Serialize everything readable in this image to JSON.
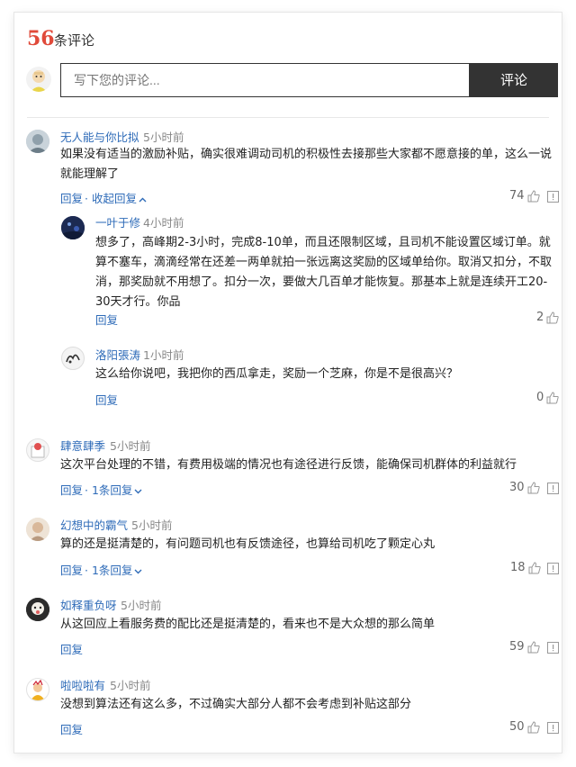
{
  "header": {
    "count": "56",
    "count_label": "条评论"
  },
  "compose": {
    "placeholder": "写下您的评论...",
    "submit_label": "评论"
  },
  "comments": [
    {
      "user": "无人能与你比拟",
      "time": "5小时前",
      "text": "如果没有适当的激励补贴，确实很难调动司机的积极性去接那些大家都不愿意接的单，这么一说就能理解了",
      "reply_label": "回复",
      "toggle_label": "· 收起回复",
      "likes": "74",
      "replies": [
        {
          "user": "一叶于修",
          "time": "4小时前",
          "text": "想多了，高峰期2-3小时，完成8-10单，而且还限制区域，且司机不能设置区域订单。就算不塞车，滴滴经常在还差一两单就拍一张远离这奖励的区域单给你。取消又扣分，不取消，那奖励就不用想了。扣分一次，要做大几百单才能恢复。那基本上就是连续开工20-30天才行。你品",
          "reply_label": "回复",
          "likes": "2"
        },
        {
          "user": "洛阳張涛",
          "time": "1小时前",
          "text": "这么给你说吧，我把你的西瓜拿走，奖励一个芝麻，你是不是很高兴？",
          "reply_label": "回复",
          "likes": "0"
        }
      ]
    },
    {
      "user": "肆意肆季",
      "time": "5小时前",
      "text": "这次平台处理的不错，有费用极端的情况也有途径进行反馈，能确保司机群体的利益就行",
      "reply_label": "回复",
      "toggle_label": "· 1条回复",
      "likes": "30"
    },
    {
      "user": "幻想中的霸气",
      "time": "5小时前",
      "text": "算的还是挺清楚的，有问题司机也有反馈途径，也算给司机吃了颗定心丸",
      "reply_label": "回复",
      "toggle_label": "· 1条回复",
      "likes": "18"
    },
    {
      "user": "如释重负呀",
      "time": "5小时前",
      "text": "从这回应上看服务费的配比还是挺清楚的，看来也不是大众想的那么简单",
      "reply_label": "回复",
      "likes": "59"
    },
    {
      "user": "啦啦啦有",
      "time": "5小时前",
      "text": "没想到算法还有这么多，不过确实大部分人都不会考虑到补贴这部分",
      "reply_label": "回复",
      "likes": "50"
    }
  ]
}
